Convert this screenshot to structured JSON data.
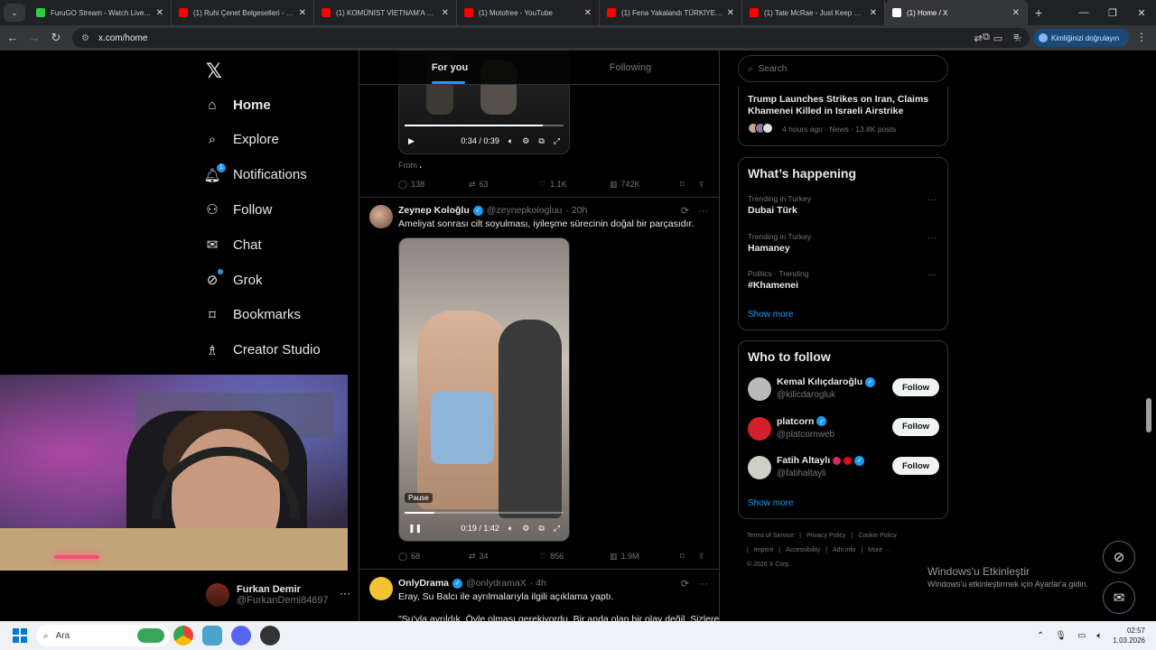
{
  "browser": {
    "tabs": [
      {
        "title": "FuruGO Stream - Watch Live on",
        "color": "#2ecc40"
      },
      {
        "title": "(1) Ruhi Çenet Belgeselleri - You",
        "color": "#ff0000"
      },
      {
        "title": "(1) KOMÜNİST VİETNAM'A GEL",
        "color": "#ff0000"
      },
      {
        "title": "(1) Motofree - YouTube",
        "color": "#ff0000"
      },
      {
        "title": "(1) Fena Yakalandı TÜRKİYE'DE",
        "color": "#ff0000"
      },
      {
        "title": "(1) Tate McRae - Just Keep Wat",
        "color": "#ff0000"
      },
      {
        "title": "(1) Home / X",
        "color": "#ffffff",
        "active": true
      }
    ],
    "url": "x.com/home",
    "profile_label": "Kimliğinizi doğrulayın"
  },
  "nav": {
    "logo": "𝕏",
    "items": [
      {
        "label": "Home",
        "icon": "home-icon",
        "bold": true
      },
      {
        "label": "Explore",
        "icon": "search-icon"
      },
      {
        "label": "Notifications",
        "icon": "bell-icon",
        "badge": "1"
      },
      {
        "label": "Follow",
        "icon": "person-add-icon"
      },
      {
        "label": "Chat",
        "icon": "mail-icon"
      },
      {
        "label": "Grok",
        "icon": "grok-icon",
        "dot": true
      },
      {
        "label": "Bookmarks",
        "icon": "bookmark-icon"
      },
      {
        "label": "Creator Studio",
        "icon": "creator-icon"
      }
    ],
    "account": {
      "name": "Furkan Demir",
      "handle": "@FurkanDemi84697"
    }
  },
  "feed": {
    "tabs": [
      {
        "label": "For you",
        "active": true
      },
      {
        "label": "Following"
      }
    ],
    "post1": {
      "video_time": "0:34 / 0:39",
      "video_progress": 0.87,
      "source": "From",
      "replies": "138",
      "reposts": "63",
      "likes": "1.1K",
      "views": "742K"
    },
    "post2": {
      "name": "Zeynep Koloğlu",
      "handle": "@zeynepkologluu",
      "time": "· 20h",
      "text": "Ameliyat sonrası cilt soyulması, iyileşme sürecinin doğal bir parçasıdır.",
      "video_time": "0:19 / 1:42",
      "video_progress": 0.19,
      "pause_tooltip": "Pause",
      "replies": "68",
      "reposts": "34",
      "likes": "856",
      "views": "1.9M"
    },
    "post3": {
      "name": "OnlyDrama",
      "handle": "@onlydramaX",
      "time": "· 4h",
      "text": "Eray, Su Balcı ile ayrılmalarıyla ilgili açıklama yaptı.",
      "text2": "\"Su'yla ayrıldık. Öyle olması gerekiyordu. Bir anda olan bir olay değil. Sizlere"
    }
  },
  "sidebar": {
    "search_placeholder": "Search",
    "news": {
      "title": "Trump Launches Strikes on Iran, Claims Khamenei Killed in Israeli Airstrike",
      "meta": "4 hours ago · News · 13.8K posts"
    },
    "happening": {
      "title": "What’s happening",
      "trends": [
        {
          "meta": "Trending in Turkey",
          "name": "Dubai Türk"
        },
        {
          "meta": "Trending in Turkey",
          "name": "Hamaney"
        },
        {
          "meta": "Politics · Trending",
          "name": "#Khamenei"
        }
      ],
      "show_more": "Show more"
    },
    "who_to_follow": {
      "title": "Who to follow",
      "users": [
        {
          "name": "Kemal Kılıçdaroğlu",
          "handle": "@kilicdarogluk",
          "button": "Follow"
        },
        {
          "name": "platcorn",
          "handle": "@platcornweb",
          "button": "Follow"
        },
        {
          "name": "Fatih Altaylı",
          "handle": "@fatihaltayli",
          "button": "Follow"
        }
      ],
      "show_more": "Show more"
    },
    "footer": [
      "Terms of Service",
      "|",
      "Privacy Policy",
      "|",
      "Cookie Policy",
      "|",
      "Imprint",
      "|",
      "Accessibility",
      "|",
      "Ads info",
      "|",
      "More ···",
      "© 2026 X Corp."
    ]
  },
  "windows": {
    "activate_title": "Windows'u Etkinleştir",
    "activate_sub": "Windows'u etkinleştirmek için Ayarlar'a gidin.",
    "search_label": "Ara",
    "time": "02:57",
    "date": "1.03.2026"
  }
}
